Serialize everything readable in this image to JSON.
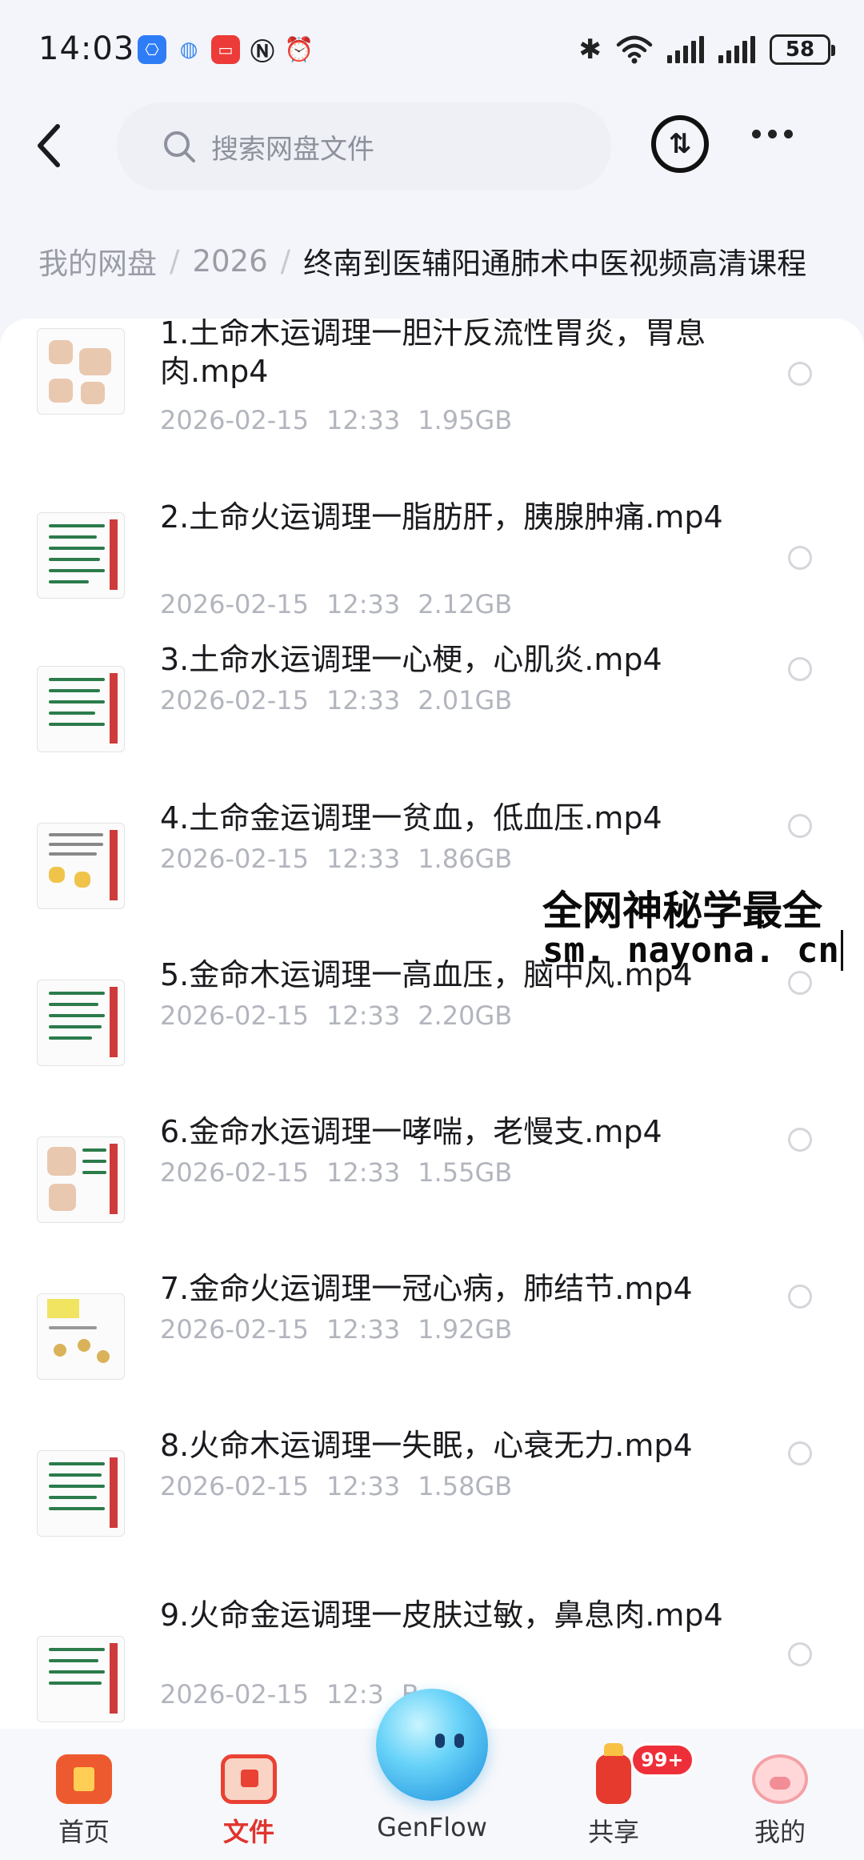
{
  "status_bar": {
    "time": "14:03",
    "battery": "58",
    "notification_icons": [
      "app-1-icon",
      "genflow-icon",
      "red-app-icon",
      "nfc-icon",
      "alarm-icon"
    ],
    "system_icons": [
      "bluetooth-icon",
      "wifi-icon",
      "signal-icon",
      "signal-icon",
      "battery-icon"
    ]
  },
  "header": {
    "search_placeholder": "搜索网盘文件"
  },
  "breadcrumb": [
    "我的网盘",
    "2026",
    "终南到医辅阳通肺术中医视频高清课程"
  ],
  "files": [
    {
      "name": "1.土命木运调理一胆汁反流性胃炎，胃息肉.mp4",
      "date": "2026-02-15",
      "time": "12:33",
      "size": "1.95GB"
    },
    {
      "name": "2.土命火运调理一脂肪肝，胰腺肿痛.mp4",
      "date": "2026-02-15",
      "time": "12:33",
      "size": "2.12GB"
    },
    {
      "name": "3.土命水运调理一心梗，心肌炎.mp4",
      "date": "2026-02-15",
      "time": "12:33",
      "size": "2.01GB"
    },
    {
      "name": "4.土命金运调理一贫血，低血压.mp4",
      "date": "2026-02-15",
      "time": "12:33",
      "size": "1.86GB"
    },
    {
      "name": "5.金命木运调理一高血压，脑中风.mp4",
      "date": "2026-02-15",
      "time": "12:33",
      "size": "2.20GB"
    },
    {
      "name": "6.金命水运调理一哮喘，老慢支.mp4",
      "date": "2026-02-15",
      "time": "12:33",
      "size": "1.55GB"
    },
    {
      "name": "7.金命火运调理一冠心病，肺结节.mp4",
      "date": "2026-02-15",
      "time": "12:33",
      "size": "1.92GB"
    },
    {
      "name": "8.火命木运调理一失眠，心衰无力.mp4",
      "date": "2026-02-15",
      "time": "12:33",
      "size": "1.58GB"
    },
    {
      "name": "9.火命金运调理一皮肤过敏，鼻息肉.mp4",
      "date": "2026-02-15",
      "time": "12:3",
      "size": "B"
    }
  ],
  "watermark": {
    "title": "全网神秘学最全",
    "url": "sm. nayona. cn"
  },
  "bottom_nav": {
    "items": [
      {
        "label": "首页",
        "icon": "home-icon"
      },
      {
        "label": "文件",
        "icon": "file-icon"
      },
      {
        "label": "GenFlow",
        "icon": "genflow-orb-icon"
      },
      {
        "label": "共享",
        "icon": "share-icon"
      },
      {
        "label": "我的",
        "icon": "profile-icon"
      }
    ],
    "active": "文件",
    "share_badge": "99+"
  },
  "colors": {
    "accent": "#e0342e",
    "text": "#1b1b1f",
    "muted": "#b2b5bd",
    "search_bg": "#eef0f6"
  }
}
